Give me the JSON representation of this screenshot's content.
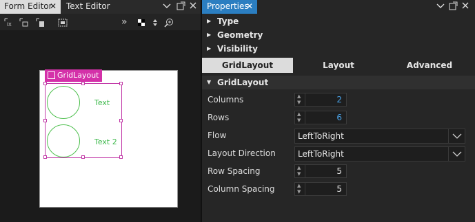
{
  "left_tabs": [
    {
      "label": "Form Editor",
      "close": "✕",
      "active": true
    },
    {
      "label": "Text Editor",
      "active": false
    }
  ],
  "toolbar": {
    "overflow": "»"
  },
  "form": {
    "layout_badge": "GridLayout",
    "items": [
      {
        "text": "Text"
      },
      {
        "text": "Text 2"
      }
    ]
  },
  "properties_tab": {
    "label": "Properties",
    "close": "✕"
  },
  "sections": {
    "type": "Type",
    "geometry": "Geometry",
    "visibility": "Visibility"
  },
  "subtabs": [
    {
      "label": "GridLayout",
      "active": true
    },
    {
      "label": "Layout",
      "active": false
    },
    {
      "label": "Advanced",
      "active": false
    }
  ],
  "grid_section": "GridLayout",
  "props": {
    "columns": {
      "label": "Columns",
      "value": "2"
    },
    "rows": {
      "label": "Rows",
      "value": "6"
    },
    "flow": {
      "label": "Flow",
      "value": "LeftToRight"
    },
    "layout_direction": {
      "label": "Layout Direction",
      "value": "LeftToRight"
    },
    "row_spacing": {
      "label": "Row Spacing",
      "value": "5"
    },
    "column_spacing": {
      "label": "Column Spacing",
      "value": "5"
    }
  },
  "colors": {
    "accent_blue": "#2b7ec1",
    "layout_magenta": "#d431a9",
    "item_green": "#3cb84a",
    "value_blue": "#4aa3e8"
  }
}
